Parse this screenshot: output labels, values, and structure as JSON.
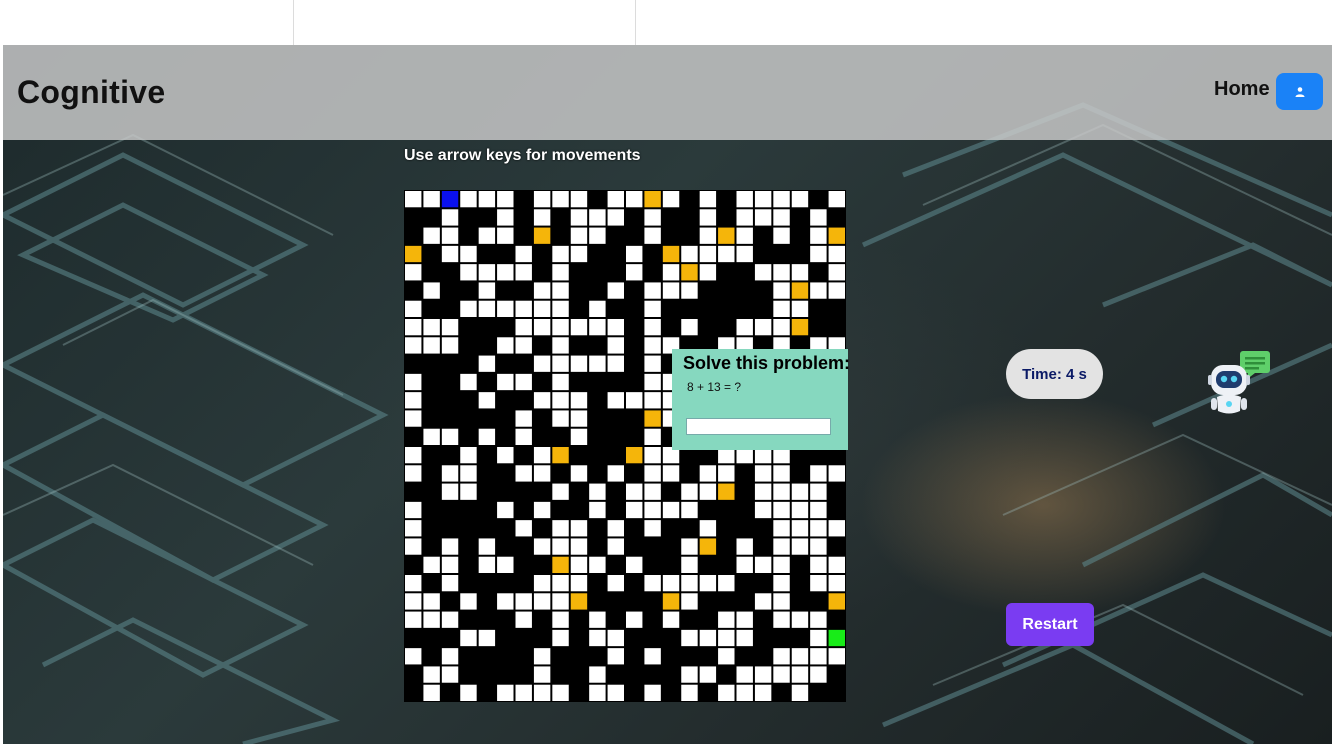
{
  "app": {
    "brand": "Cognitive"
  },
  "nav": {
    "home_label": "Home",
    "user_icon": "user-icon"
  },
  "game": {
    "hint": "Use arrow keys for movements",
    "timer_label": "Time: 4 s",
    "restart_label": "Restart",
    "problem": {
      "title": "Solve this problem:",
      "question": "8 + 13 = ?",
      "answer_value": ""
    }
  },
  "maze": {
    "rows": 28,
    "cols": 24,
    "grid": [
      "WWPWWWBWWWBWWBWBWBWWWWBW",
      "BBWBBWBWBWWWBWBBWBWWWBWB",
      "BWWBWWBBBWWBBWBBWWWBWBWB",
      "WBWWBBWBWWBBWBBWWWWBBBWW",
      "WBBWWWWBWBBBWBWWWBBWWWBW",
      "BWBBWBBWWBBWBWWWBBBBWWWW",
      "WBBWWWWWWBWBBWBBBBBBWWBB",
      "WWWBBBWWWWWWBWBWBBWWWBBB",
      "WWWBBWWBWBBWBWWBBWWBWBWW",
      "BBBBWBBWWWWWBWBBBWWWBWWB",
      "WBBWBWWBWBBBBWWWBWBWBBBB",
      "WBBBWBBWWWBWWWWBBBBBBBWW",
      "WBBBBBWBWWBBBWWBBBBWBBWW",
      "BWWBWBWBBWBBBWBBWBBBWWWB",
      "WBBWBWBWBBBBBWWBBWWWWBBB",
      "WBWWBBWWBWBWBWWBWWBWWBWW",
      "BBWWBBBBWBWBWWBWWBBWWWWB",
      "WBBBBWBWBBWBWWWWBBBWWWWB",
      "WBBBBBWBWWBWBWBBWBBBWWWW",
      "WBWBWBBWWWBWBBBWWBWBWWWB",
      "BWWBWWBBWWWBWBBWBBWWWBWW",
      "WBWBBBBWWWBWBWWWWWBBWBWW",
      "WWBWBWWWWWBBBBBWBBBWWBBW",
      "WWWBBBWBWBWBWBWBBWWBWWWB",
      "BBBWWBBBWBWWBBBWWWWBBBWW",
      "WBWBBBBWBBBWBWBBBWBBWWWW",
      "BWWBBBBWBBWBBBBWWBWWWWWB",
      "BWBWBWWWWBWWBWBWBWWWBWBB"
    ],
    "coins": [
      [
        0,
        13
      ],
      [
        2,
        7
      ],
      [
        2,
        17
      ],
      [
        2,
        23
      ],
      [
        3,
        0
      ],
      [
        3,
        14
      ],
      [
        4,
        15
      ],
      [
        5,
        21
      ],
      [
        7,
        21
      ],
      [
        12,
        13
      ],
      [
        13,
        17
      ],
      [
        14,
        8
      ],
      [
        14,
        12
      ],
      [
        16,
        17
      ],
      [
        19,
        16
      ],
      [
        20,
        8
      ],
      [
        22,
        9
      ],
      [
        22,
        14
      ],
      [
        22,
        23
      ]
    ],
    "player": [
      0,
      2
    ],
    "goal": [
      24,
      23
    ],
    "colors": {
      "wall": "#000000",
      "path": "#ffffff",
      "player": "#0a10ee",
      "coin": "#f5b50a",
      "goal": "#18ec18"
    }
  }
}
